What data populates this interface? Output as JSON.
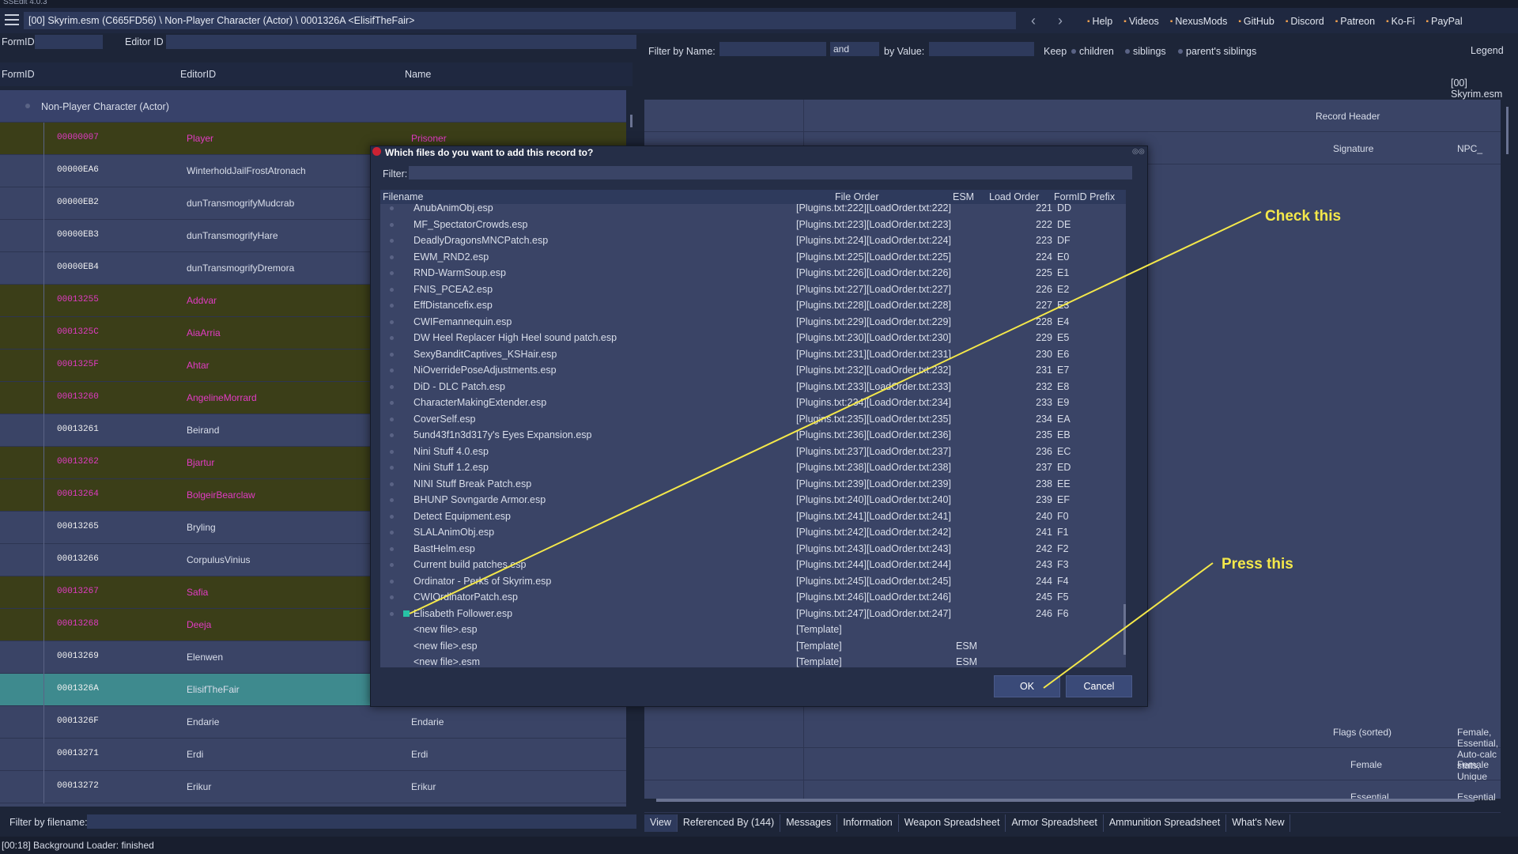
{
  "app_title": "SSEdit 4.0.3",
  "path": "[00] Skyrim.esm (C665FD56) \\ Non-Player Character (Actor) \\ 0001326A <ElisifTheFair>",
  "nav": {
    "back": "‹",
    "forward": "›"
  },
  "toplinks": [
    {
      "label": "Help",
      "icon": "help-icon"
    },
    {
      "label": "Videos",
      "icon": "video-icon"
    },
    {
      "label": "NexusMods",
      "icon": "nexus-icon"
    },
    {
      "label": "GitHub",
      "icon": "github-icon"
    },
    {
      "label": "Discord",
      "icon": "discord-icon"
    },
    {
      "label": "Patreon",
      "icon": "patreon-icon"
    },
    {
      "label": "Ko-Fi",
      "icon": "kofi-icon"
    },
    {
      "label": "PayPal",
      "icon": "paypal-icon"
    }
  ],
  "left_filter": {
    "formid_label": "FormID",
    "editorid_label": "Editor ID"
  },
  "left_columns": {
    "formid": "FormID",
    "editorid": "EditorID",
    "name": "Name"
  },
  "group_label": "Non-Player Character (Actor)",
  "records": [
    {
      "formid": "00000007",
      "editorid": "Player",
      "name": "Prisoner",
      "style": "olive"
    },
    {
      "formid": "00000EA6",
      "editorid": "WinterholdJailFrostAtronach",
      "name": "",
      "style": "normal"
    },
    {
      "formid": "00000EB2",
      "editorid": "dunTransmogrifyMudcrab",
      "name": "",
      "style": "normal"
    },
    {
      "formid": "00000EB3",
      "editorid": "dunTransmogrifyHare",
      "name": "",
      "style": "normal"
    },
    {
      "formid": "00000EB4",
      "editorid": "dunTransmogrifyDremora",
      "name": "",
      "style": "normal"
    },
    {
      "formid": "00013255",
      "editorid": "Addvar",
      "name": "",
      "style": "olive"
    },
    {
      "formid": "0001325C",
      "editorid": "AiaArria",
      "name": "",
      "style": "olive"
    },
    {
      "formid": "0001325F",
      "editorid": "Ahtar",
      "name": "",
      "style": "olive"
    },
    {
      "formid": "00013260",
      "editorid": "AngelineMorrard",
      "name": "",
      "style": "olive"
    },
    {
      "formid": "00013261",
      "editorid": "Beirand",
      "name": "",
      "style": "normal"
    },
    {
      "formid": "00013262",
      "editorid": "Bjartur",
      "name": "",
      "style": "olive"
    },
    {
      "formid": "00013264",
      "editorid": "BolgeirBearclaw",
      "name": "",
      "style": "olive"
    },
    {
      "formid": "00013265",
      "editorid": "Bryling",
      "name": "",
      "style": "normal"
    },
    {
      "formid": "00013266",
      "editorid": "CorpulusVinius",
      "name": "",
      "style": "normal"
    },
    {
      "formid": "00013267",
      "editorid": "Safia",
      "name": "",
      "style": "olive"
    },
    {
      "formid": "00013268",
      "editorid": "Deeja",
      "name": "",
      "style": "olive"
    },
    {
      "formid": "00013269",
      "editorid": "Elenwen",
      "name": "",
      "style": "normal"
    },
    {
      "formid": "0001326A",
      "editorid": "ElisifTheFair",
      "name": "",
      "style": "sel"
    },
    {
      "formid": "0001326F",
      "editorid": "Endarie",
      "name": "Endarie",
      "style": "normal"
    },
    {
      "formid": "00013271",
      "editorid": "Erdi",
      "name": "Erdi",
      "style": "normal"
    },
    {
      "formid": "00013272",
      "editorid": "Erikur",
      "name": "Erikur",
      "style": "normal"
    }
  ],
  "right_filter": {
    "by_name": "Filter by Name:",
    "and": "and",
    "by_value": "by Value:",
    "keep": "Keep",
    "children": "children",
    "siblings": "siblings",
    "parents_siblings": "parent's siblings",
    "legend": "Legend"
  },
  "right_header": "[00] Skyrim.esm",
  "right_rows": [
    {
      "key": "Record Header",
      "value": "",
      "indent": 0
    },
    {
      "key": "Signature",
      "value": "NPC_",
      "indent": 1
    }
  ],
  "right_bottom_rows": [
    {
      "key": "Flags (sorted)",
      "value": "Female, Essential, Auto-calc stats, Unique",
      "indent": 1
    },
    {
      "key": "Female",
      "value": "Female",
      "indent": 2
    },
    {
      "key": "Essential",
      "value": "Essential",
      "indent": 2
    }
  ],
  "bottom_tabs": [
    "View",
    "Referenced By (144)",
    "Messages",
    "Information",
    "Weapon Spreadsheet",
    "Armor Spreadsheet",
    "Ammunition Spreadsheet",
    "What's New"
  ],
  "filter_filename_label": "Filter by filename:",
  "status": "[00:18] Background Loader: finished",
  "dialog": {
    "title": "Which files do you want to add this record to?",
    "filter_label": "Filter:",
    "columns": {
      "filename": "Filename",
      "file_order": "File Order",
      "esm": "ESM",
      "load_order": "Load Order",
      "prefix": "FormID Prefix"
    },
    "files": [
      {
        "filename": "AnubAnimObj.esp",
        "order": "[Plugins.txt:222][LoadOrder.txt:222]",
        "esm": "",
        "lo": "221",
        "prefix": "DD"
      },
      {
        "filename": "MF_SpectatorCrowds.esp",
        "order": "[Plugins.txt:223][LoadOrder.txt:223]",
        "esm": "",
        "lo": "222",
        "prefix": "DE"
      },
      {
        "filename": "DeadlyDragonsMNCPatch.esp",
        "order": "[Plugins.txt:224][LoadOrder.txt:224]",
        "esm": "",
        "lo": "223",
        "prefix": "DF"
      },
      {
        "filename": "EWM_RND2.esp",
        "order": "[Plugins.txt:225][LoadOrder.txt:225]",
        "esm": "",
        "lo": "224",
        "prefix": "E0"
      },
      {
        "filename": "RND-WarmSoup.esp",
        "order": "[Plugins.txt:226][LoadOrder.txt:226]",
        "esm": "",
        "lo": "225",
        "prefix": "E1"
      },
      {
        "filename": "FNIS_PCEA2.esp",
        "order": "[Plugins.txt:227][LoadOrder.txt:227]",
        "esm": "",
        "lo": "226",
        "prefix": "E2"
      },
      {
        "filename": "EffDistancefix.esp",
        "order": "[Plugins.txt:228][LoadOrder.txt:228]",
        "esm": "",
        "lo": "227",
        "prefix": "E3"
      },
      {
        "filename": "CWIFemannequin.esp",
        "order": "[Plugins.txt:229][LoadOrder.txt:229]",
        "esm": "",
        "lo": "228",
        "prefix": "E4"
      },
      {
        "filename": "DW Heel Replacer High Heel sound patch.esp",
        "order": "[Plugins.txt:230][LoadOrder.txt:230]",
        "esm": "",
        "lo": "229",
        "prefix": "E5"
      },
      {
        "filename": "SexyBanditCaptives_KSHair.esp",
        "order": "[Plugins.txt:231][LoadOrder.txt:231]",
        "esm": "",
        "lo": "230",
        "prefix": "E6"
      },
      {
        "filename": "NiOverridePoseAdjustments.esp",
        "order": "[Plugins.txt:232][LoadOrder.txt:232]",
        "esm": "",
        "lo": "231",
        "prefix": "E7"
      },
      {
        "filename": "DiD - DLC Patch.esp",
        "order": "[Plugins.txt:233][LoadOrder.txt:233]",
        "esm": "",
        "lo": "232",
        "prefix": "E8"
      },
      {
        "filename": "CharacterMakingExtender.esp",
        "order": "[Plugins.txt:234][LoadOrder.txt:234]",
        "esm": "",
        "lo": "233",
        "prefix": "E9"
      },
      {
        "filename": "CoverSelf.esp",
        "order": "[Plugins.txt:235][LoadOrder.txt:235]",
        "esm": "",
        "lo": "234",
        "prefix": "EA"
      },
      {
        "filename": "5und43f1n3d317y's Eyes Expansion.esp",
        "order": "[Plugins.txt:236][LoadOrder.txt:236]",
        "esm": "",
        "lo": "235",
        "prefix": "EB"
      },
      {
        "filename": "Nini Stuff 4.0.esp",
        "order": "[Plugins.txt:237][LoadOrder.txt:237]",
        "esm": "",
        "lo": "236",
        "prefix": "EC"
      },
      {
        "filename": "Nini Stuff 1.2.esp",
        "order": "[Plugins.txt:238][LoadOrder.txt:238]",
        "esm": "",
        "lo": "237",
        "prefix": "ED"
      },
      {
        "filename": "NINI Stuff Break Patch.esp",
        "order": "[Plugins.txt:239][LoadOrder.txt:239]",
        "esm": "",
        "lo": "238",
        "prefix": "EE"
      },
      {
        "filename": "BHUNP Sovngarde Armor.esp",
        "order": "[Plugins.txt:240][LoadOrder.txt:240]",
        "esm": "",
        "lo": "239",
        "prefix": "EF"
      },
      {
        "filename": "Detect Equipment.esp",
        "order": "[Plugins.txt:241][LoadOrder.txt:241]",
        "esm": "",
        "lo": "240",
        "prefix": "F0"
      },
      {
        "filename": "SLALAnimObj.esp",
        "order": "[Plugins.txt:242][LoadOrder.txt:242]",
        "esm": "",
        "lo": "241",
        "prefix": "F1"
      },
      {
        "filename": "BastHelm.esp",
        "order": "[Plugins.txt:243][LoadOrder.txt:243]",
        "esm": "",
        "lo": "242",
        "prefix": "F2"
      },
      {
        "filename": "Current build patches.esp",
        "order": "[Plugins.txt:244][LoadOrder.txt:244]",
        "esm": "",
        "lo": "243",
        "prefix": "F3"
      },
      {
        "filename": "Ordinator - Perks of Skyrim.esp",
        "order": "[Plugins.txt:245][LoadOrder.txt:245]",
        "esm": "",
        "lo": "244",
        "prefix": "F4"
      },
      {
        "filename": "CWIOrdinatorPatch.esp",
        "order": "[Plugins.txt:246][LoadOrder.txt:246]",
        "esm": "",
        "lo": "245",
        "prefix": "F5"
      },
      {
        "filename": "Elisabeth Follower.esp",
        "order": "[Plugins.txt:247][LoadOrder.txt:247]",
        "esm": "",
        "lo": "246",
        "prefix": "F6",
        "checked": true
      },
      {
        "filename": "<new file>.esp",
        "order": "[Template]",
        "esm": "",
        "lo": "",
        "prefix": ""
      },
      {
        "filename": "<new file>.esp",
        "order": "[Template]",
        "esm": "ESM",
        "lo": "",
        "prefix": ""
      },
      {
        "filename": "<new file>.esm",
        "order": "[Template]",
        "esm": "ESM",
        "lo": "",
        "prefix": ""
      }
    ],
    "ok": "OK",
    "cancel": "Cancel"
  },
  "annotations": {
    "check": "Check this",
    "press": "Press this",
    "color": "#f4e84a"
  }
}
